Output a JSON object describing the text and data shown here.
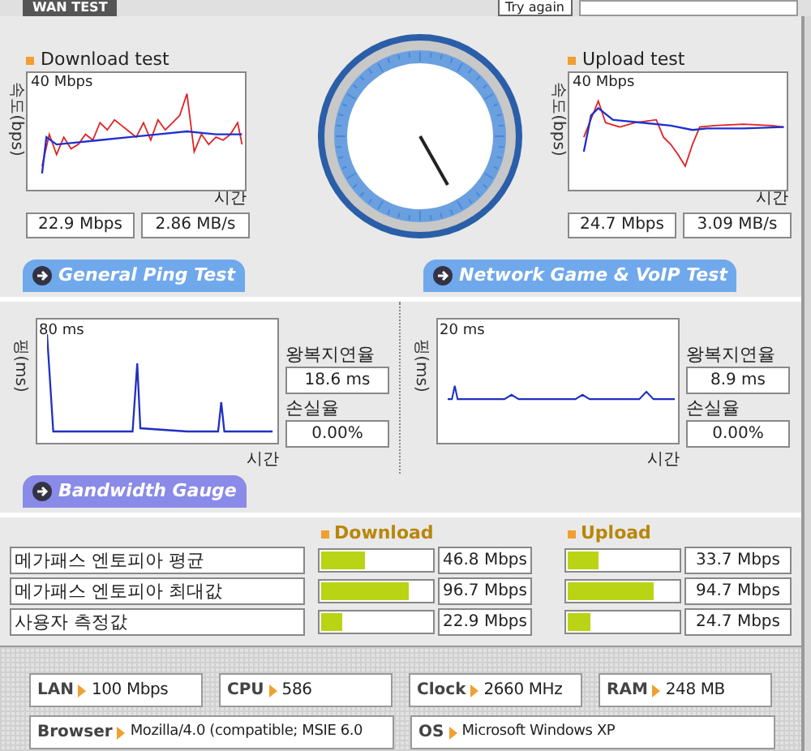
{
  "header": {
    "title": "WAN TEST",
    "button": "Try again"
  },
  "speed_tests": [
    {
      "title": "Download test",
      "y_axis": "속도(bps)",
      "max_label": "40 Mbps",
      "x_axis": "시간",
      "readings": [
        "22.9 Mbps",
        "2.86 MB/s"
      ]
    },
    {
      "title": "Upload test",
      "y_axis": "속도(bps)",
      "max_label": "40 Mbps",
      "x_axis": "시간",
      "readings": [
        "24.7 Mbps",
        "3.09 MB/s"
      ]
    }
  ],
  "ping_tests": [
    {
      "tab": "General Ping Test",
      "y_axis": "핑(ms)",
      "max_label": "80 ms",
      "x_axis": "시간",
      "latency_label": "왕복지연율",
      "latency": "18.6 ms",
      "loss_label": "손실율",
      "loss": "0.00%"
    },
    {
      "tab": "Network Game & VoIP Test",
      "y_axis": "핑(ms)",
      "max_label": "20 ms",
      "x_axis": "시간",
      "latency_label": "왕복지연율",
      "latency": "8.9 ms",
      "loss_label": "손실율",
      "loss": "0.00%"
    }
  ],
  "bandwidth_gauge": {
    "tab": "Bandwidth Gauge",
    "columns": [
      "Download",
      "Upload"
    ],
    "rows": [
      {
        "label": "메가패스 엔토피아 평균",
        "download": {
          "level": 0.4,
          "value": "46.8 Mbps"
        },
        "upload": {
          "level": 0.28,
          "value": "33.7 Mbps"
        }
      },
      {
        "label": "메가패스 엔토피아 최대값",
        "download": {
          "level": 0.8,
          "value": "96.7 Mbps"
        },
        "upload": {
          "level": 0.78,
          "value": "94.7 Mbps"
        }
      },
      {
        "label": "사용자 측정값",
        "download": {
          "level": 0.19,
          "value": "22.9 Mbps"
        },
        "upload": {
          "level": 0.2,
          "value": "24.7 Mbps"
        }
      }
    ]
  },
  "system_info": [
    [
      {
        "label": "LAN",
        "value": "100 Mbps"
      },
      {
        "label": "CPU",
        "value": "586"
      },
      {
        "label": "Clock",
        "value": "2660 MHz"
      },
      {
        "label": "RAM",
        "value": "248 MB"
      }
    ],
    [
      {
        "label": "Browser",
        "value": "Mozilla/4.0 (compatible; MSIE 6.0"
      },
      {
        "label": "OS",
        "value": "Microsoft Windows XP"
      }
    ]
  ]
}
